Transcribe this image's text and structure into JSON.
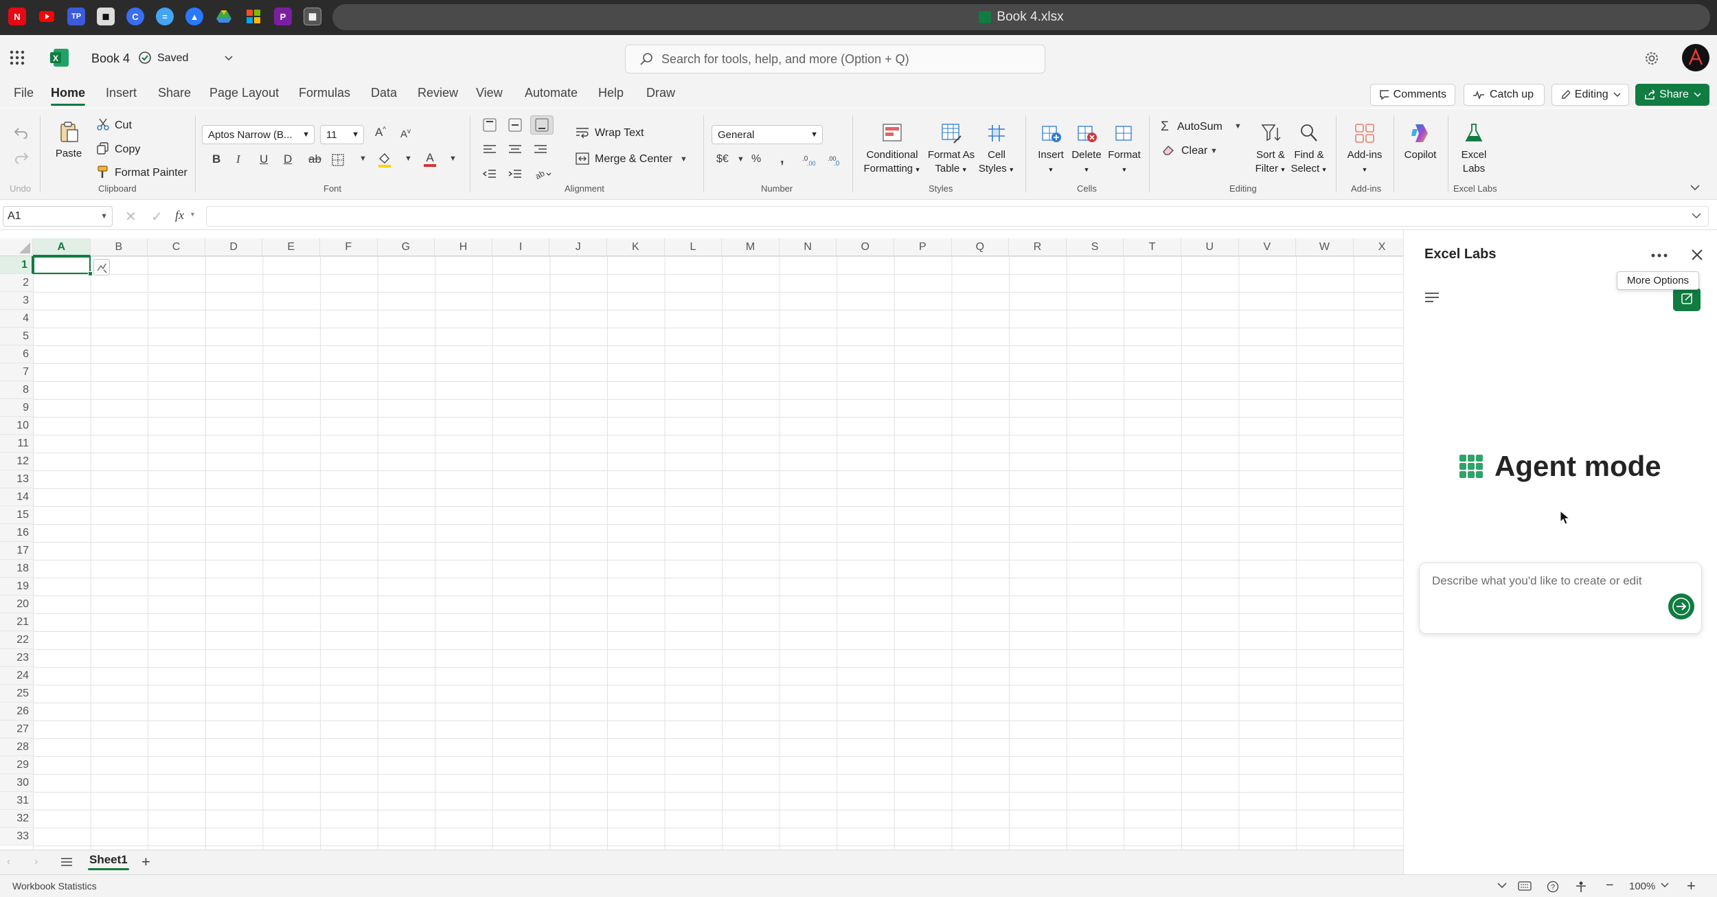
{
  "browser": {
    "tab_title": "Book 4.xlsx"
  },
  "header": {
    "workbook": "Book 4",
    "saved": "Saved",
    "search_placeholder": "Search for tools, help, and more (Option + Q)"
  },
  "tabs": [
    "File",
    "Home",
    "Insert",
    "Share",
    "Page Layout",
    "Formulas",
    "Data",
    "Review",
    "View",
    "Automate",
    "Help",
    "Draw"
  ],
  "top_buttons": {
    "comments": "Comments",
    "catchup": "Catch up",
    "editing": "Editing",
    "share": "Share"
  },
  "ribbon": {
    "undo": "Undo",
    "clipboard": {
      "paste": "Paste",
      "cut": "Cut",
      "copy": "Copy",
      "format_painter": "Format Painter",
      "label": "Clipboard"
    },
    "font": {
      "name": "Aptos Narrow (B...",
      "size": "11",
      "label": "Font"
    },
    "alignment": {
      "wrap": "Wrap Text",
      "merge": "Merge & Center",
      "label": "Alignment"
    },
    "number": {
      "format": "General",
      "label": "Number"
    },
    "styles": {
      "cond1": "Conditional",
      "cond2": "Formatting",
      "table1": "Format As",
      "table2": "Table",
      "cell1": "Cell",
      "cell2": "Styles",
      "label": "Styles"
    },
    "cells": {
      "insert": "Insert",
      "delete": "Delete",
      "format": "Format",
      "label": "Cells"
    },
    "editing": {
      "autosum": "AutoSum",
      "clear": "Clear",
      "sort1": "Sort &",
      "sort2": "Filter",
      "find1": "Find &",
      "find2": "Select",
      "label": "Editing"
    },
    "addins": {
      "btn": "Add-ins",
      "label": "Add-ins"
    },
    "copilot": "Copilot",
    "excellabs": {
      "btn1": "Excel",
      "btn2": "Labs",
      "label": "Excel Labs"
    }
  },
  "formula_bar": {
    "namebox": "A1",
    "fx": "fx"
  },
  "columns": [
    "A",
    "B",
    "C",
    "D",
    "E",
    "F",
    "G",
    "H",
    "I",
    "J",
    "K",
    "L",
    "M",
    "N",
    "O",
    "P",
    "Q",
    "R",
    "S",
    "T",
    "U",
    "V",
    "W",
    "X"
  ],
  "rows": [
    "1",
    "2",
    "3",
    "4",
    "5",
    "6",
    "7",
    "8",
    "9",
    "10",
    "11",
    "12",
    "13",
    "14",
    "15",
    "16",
    "17",
    "18",
    "19",
    "20",
    "21",
    "22",
    "23",
    "24",
    "25",
    "26",
    "27",
    "28",
    "29",
    "30",
    "31",
    "32",
    "33"
  ],
  "sheet": {
    "name": "Sheet1"
  },
  "status": {
    "stats": "Workbook Statistics",
    "zoom": "100%"
  },
  "panel": {
    "title": "Excel Labs",
    "tooltip": "More Options",
    "agent_title": "Agent mode",
    "prompt_placeholder": "Describe what you'd like to create or edit"
  },
  "colors": {
    "accent": "#107c41",
    "header_bg": "#f3f3f3"
  }
}
